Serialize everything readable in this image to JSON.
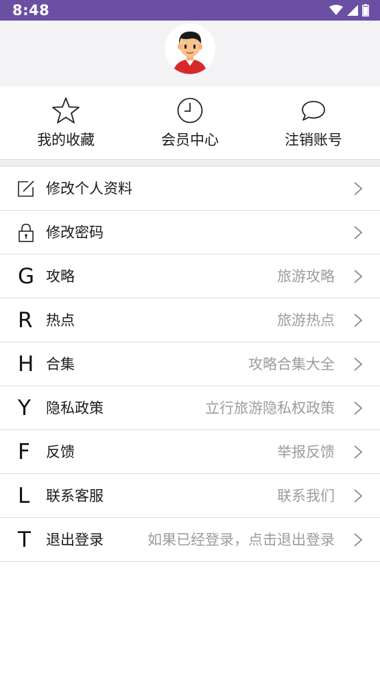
{
  "status_bar": {
    "time": "8:48",
    "icons": [
      "wifi-icon",
      "signal-icon",
      "battery-icon"
    ],
    "color": "#6a4fa3"
  },
  "profile": {
    "avatar_icon": "user-avatar-icon"
  },
  "shortcuts": [
    {
      "label": "我的收藏",
      "icon": "star-icon"
    },
    {
      "label": "会员中心",
      "icon": "clock-icon"
    },
    {
      "label": "注销账号",
      "icon": "chat-bubble-icon"
    }
  ],
  "menu": [
    {
      "icon": "edit-icon",
      "letter": "",
      "title": "修改个人资料",
      "sub": ""
    },
    {
      "icon": "lock-icon",
      "letter": "",
      "title": "修改密码",
      "sub": ""
    },
    {
      "icon": "",
      "letter": "G",
      "title": "攻略",
      "sub": "旅游攻略"
    },
    {
      "icon": "",
      "letter": "R",
      "title": "热点",
      "sub": "旅游热点"
    },
    {
      "icon": "",
      "letter": "H",
      "title": "合集",
      "sub": "攻略合集大全"
    },
    {
      "icon": "",
      "letter": "Y",
      "title": "隐私政策",
      "sub": "立行旅游隐私权政策"
    },
    {
      "icon": "",
      "letter": "F",
      "title": "反馈",
      "sub": "举报反馈"
    },
    {
      "icon": "",
      "letter": "L",
      "title": "联系客服",
      "sub": "联系我们"
    },
    {
      "icon": "",
      "letter": "T",
      "title": "退出登录",
      "sub": "如果已经登录，点击退出登录"
    }
  ]
}
